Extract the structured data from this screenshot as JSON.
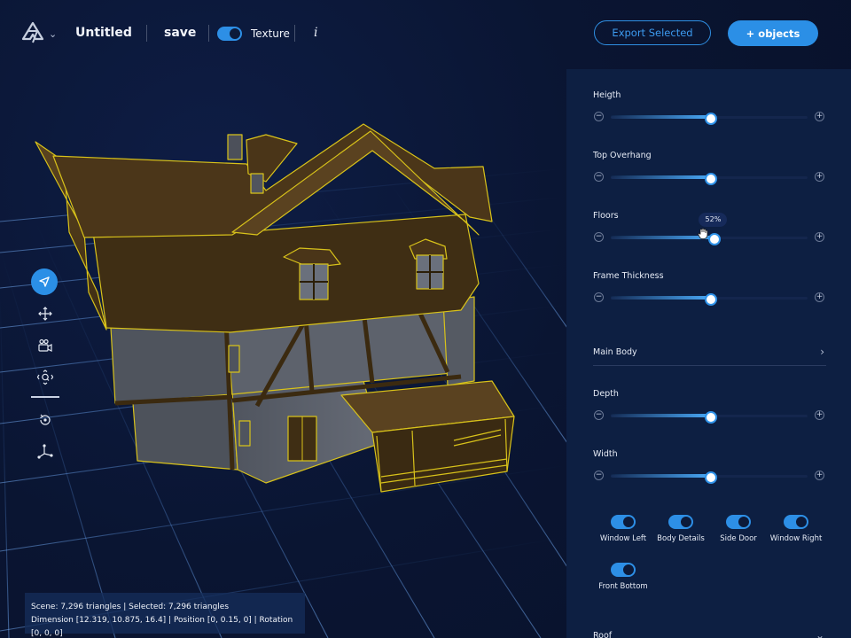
{
  "app": {
    "title": "Untitled",
    "save_label": "save",
    "texture_label": "Texture",
    "texture_enabled": true,
    "info_label": "i",
    "export_label": "Export Selected",
    "add_objects_label": "+ objects"
  },
  "colors": {
    "accent": "#2b8fe6",
    "background": "#0a1530",
    "panel": "#0d1f42",
    "selection_outline": "#d8c21a",
    "roof": "#4a3618",
    "wall": "#5a5e68"
  },
  "toolbar": {
    "tools": [
      {
        "name": "select",
        "icon": "cursor-arrow-icon",
        "active": true
      },
      {
        "name": "move",
        "icon": "move-arrows-icon",
        "active": false
      },
      {
        "name": "camera",
        "icon": "camera-icon",
        "active": false
      },
      {
        "name": "zoom-orbit",
        "icon": "orbit-zoom-icon",
        "active": false
      },
      {
        "name": "rotate",
        "icon": "rotate-icon",
        "active": false
      },
      {
        "name": "axes",
        "icon": "axes-icon",
        "active": false
      }
    ]
  },
  "status": {
    "line1": "Scene: 7,296 triangles | Selected: 7,296 triangles",
    "line2": "Dimension [12.319, 10.875, 16.4] | Position [0, 0.15, 0] | Rotation [0, 0, 0]"
  },
  "panel": {
    "sliders_top": [
      {
        "label": "Heigth",
        "value": 0.5
      },
      {
        "label": "Top Overhang",
        "value": 0.5
      },
      {
        "label": "Floors",
        "value": 0.52,
        "tooltip": "52%"
      },
      {
        "label": "Frame Thickness",
        "value": 0.5
      }
    ],
    "main_body": {
      "label": "Main Body",
      "sliders": [
        {
          "label": "Depth",
          "value": 0.5
        },
        {
          "label": "Width",
          "value": 0.5
        }
      ],
      "toggles": [
        {
          "label": "Window Left",
          "enabled": true
        },
        {
          "label": "Body Details",
          "enabled": true
        },
        {
          "label": "Side Door",
          "enabled": true
        },
        {
          "label": "Window Right",
          "enabled": true
        },
        {
          "label": "Front Bottom",
          "enabled": true
        }
      ]
    },
    "roof": {
      "label": "Roof"
    }
  }
}
